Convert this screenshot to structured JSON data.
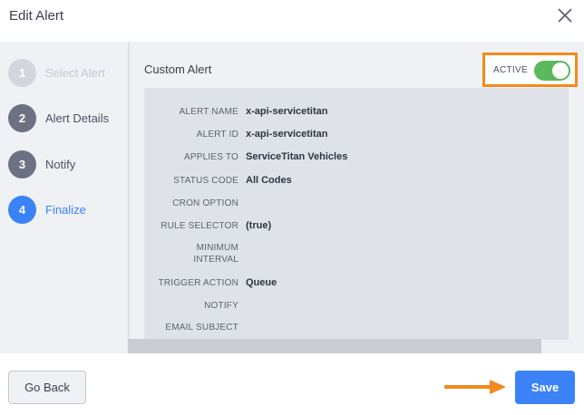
{
  "header": {
    "title": "Edit Alert",
    "close_icon": "close-icon"
  },
  "steps": [
    {
      "number": "1",
      "label": "Select Alert",
      "state": "disabled"
    },
    {
      "number": "2",
      "label": "Alert Details",
      "state": "done"
    },
    {
      "number": "3",
      "label": "Notify",
      "state": "done"
    },
    {
      "number": "4",
      "label": "Finalize",
      "state": "active"
    }
  ],
  "panel": {
    "title": "Custom Alert",
    "active_label": "ACTIVE",
    "active_on": true,
    "rows": [
      {
        "label": "ALERT NAME",
        "value": "x-api-servicetitan"
      },
      {
        "label": "ALERT ID",
        "value": "x-api-servicetitan"
      },
      {
        "label": "APPLIES TO",
        "value": "ServiceTitan Vehicles"
      },
      {
        "label": "STATUS CODE",
        "value": "All Codes"
      },
      {
        "label": "CRON OPTION",
        "value": ""
      },
      {
        "label": "RULE SELECTOR",
        "value": "(true)"
      },
      {
        "label": "MINIMUM INTERVAL",
        "value": ""
      },
      {
        "label": "TRIGGER ACTION",
        "value": "Queue"
      },
      {
        "label": "NOTIFY",
        "value": ""
      },
      {
        "label": "EMAIL SUBJECT",
        "value": ""
      }
    ]
  },
  "footer": {
    "back_label": "Go Back",
    "save_label": "Save"
  },
  "colors": {
    "accent": "#3b82f6",
    "highlight": "#f28a1c",
    "toggle_on": "#5cb85c"
  }
}
